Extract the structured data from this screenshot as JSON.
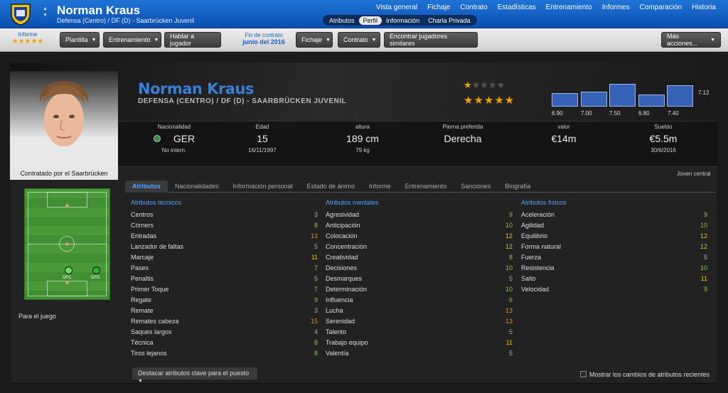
{
  "header": {
    "name": "Norman Kraus",
    "subtitle": "Defensa (Centro) / DF (D) - Saarbrücken Juvenil",
    "nav": [
      "Vista general",
      "Fichaje",
      "Contrato",
      "Estadísticas",
      "Entrenamiento",
      "Informes",
      "Comparación",
      "Historia"
    ],
    "subtabs": [
      "Atributos",
      "Perfil",
      "Información",
      "Charla Privada"
    ],
    "active_subtab": "Perfil"
  },
  "toolbar": {
    "informe_label": "Informe",
    "informe_stars": "★★★★★",
    "plantilla": "Plantilla",
    "entrenamiento": "Entrenamiento",
    "hablar": "Hablar a jugador",
    "contract_label": "Fin de contrato",
    "contract_value": "junio del 2016",
    "fichaje": "Fichaje",
    "contrato": "Contrato",
    "similares": "Encontrar jugadores similares",
    "mas": "Más acciones..."
  },
  "profile": {
    "name": "Norman Kraus",
    "position": "DEFENSA (CENTRO) / DF (D) - SAARBRÜCKEN JUVENIL",
    "current_ability_stars": 1,
    "potential_ability_stars": 5,
    "contracted_by": "Contratado por el Saarbrücken",
    "role_type": "Joven central"
  },
  "ratings": {
    "values": [
      6.9,
      7.0,
      7.5,
      6.8,
      7.4
    ],
    "labels": [
      "6.90",
      "7.00",
      "7.50",
      "6.80",
      "7.40"
    ],
    "current": "7.12"
  },
  "stats": {
    "nat_label": "Nacionalidad",
    "nat_value": "GER",
    "nat_sub": "No intern.",
    "age_label": "Edad",
    "age_value": "15",
    "age_sub": "16/11/1997",
    "height_label": "altura",
    "height_value": "189 cm",
    "height_sub": "79 kg",
    "foot_label": "Pierna preferida",
    "foot_value": "Derecha",
    "value_label": "valor",
    "value_value": "€14m",
    "wage_label": "Sueldo",
    "wage_value": "€5.5m",
    "wage_sub": "30/6/2016"
  },
  "pitch": {
    "labels": [
      "DFD",
      "DFC"
    ],
    "plays_for": "Para el juego"
  },
  "tabs": [
    "Atributos",
    "Nacionalidades",
    "Información personal",
    "Estado de ánimo",
    "Informe",
    "Entrenamiento",
    "Sanciones",
    "Biografía"
  ],
  "attributes": {
    "technical_title": "Atributos técnicos",
    "technical": [
      {
        "name": "Centros",
        "value": "3"
      },
      {
        "name": "Córners",
        "value": "8"
      },
      {
        "name": "Entradas",
        "value": "13"
      },
      {
        "name": "Lanzador de faltas",
        "value": "5"
      },
      {
        "name": "Marcaje",
        "value": "11"
      },
      {
        "name": "Pases",
        "value": "7"
      },
      {
        "name": "Penaltis",
        "value": "5"
      },
      {
        "name": "Primer Toque",
        "value": "7"
      },
      {
        "name": "Regate",
        "value": "9"
      },
      {
        "name": "Remate",
        "value": "3"
      },
      {
        "name": "Remates cabeza",
        "value": "15"
      },
      {
        "name": "Saques largos",
        "value": "4"
      },
      {
        "name": "Técnica",
        "value": "8"
      },
      {
        "name": "Tiros lejanos",
        "value": "8"
      }
    ],
    "mental_title": "Atributos mentales",
    "mental": [
      {
        "name": "Agresividad",
        "value": "9"
      },
      {
        "name": "Anticipación",
        "value": "10"
      },
      {
        "name": "Colocación",
        "value": "12"
      },
      {
        "name": "Concentración",
        "value": "12"
      },
      {
        "name": "Creatividad",
        "value": "8"
      },
      {
        "name": "Decisiones",
        "value": "10"
      },
      {
        "name": "Desmarques",
        "value": "5"
      },
      {
        "name": "Determinación",
        "value": "10"
      },
      {
        "name": "Influencia",
        "value": "6"
      },
      {
        "name": "Lucha",
        "value": "13"
      },
      {
        "name": "Serenidad",
        "value": "13"
      },
      {
        "name": "Talento",
        "value": "5"
      },
      {
        "name": "Trabajo equipo",
        "value": "11"
      },
      {
        "name": "Valentía",
        "value": "5"
      }
    ],
    "physical_title": "Atributos físicos",
    "physical": [
      {
        "name": "Aceleración",
        "value": "9"
      },
      {
        "name": "Agilidad",
        "value": "10"
      },
      {
        "name": "Equilibrio",
        "value": "12"
      },
      {
        "name": "Forma natural",
        "value": "12"
      },
      {
        "name": "Fuerza",
        "value": "5"
      },
      {
        "name": "Resistencia",
        "value": "10"
      },
      {
        "name": "Salto",
        "value": "11"
      },
      {
        "name": "Velocidad",
        "value": "9"
      }
    ]
  },
  "footer": {
    "highlight_btn": "Destacar atributos clave para el puesto",
    "show_changes": "Mostrar los cambios de atributos recientes"
  },
  "colors": {
    "low": "#aaaaaa",
    "mid": "#8cc63f",
    "good": "#e8c000",
    "high": "#f08a00"
  }
}
